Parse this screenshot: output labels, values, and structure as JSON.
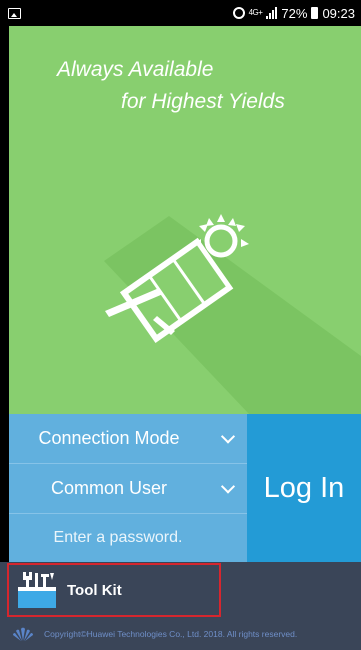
{
  "status_bar": {
    "network": "4G+",
    "battery": "72%",
    "time": "09:23"
  },
  "hero": {
    "tagline_line1": "Always Available",
    "tagline_line2": "for Highest Yields"
  },
  "login": {
    "connection_mode_label": "Connection Mode",
    "user_type_label": "Common User",
    "password_placeholder": "Enter a password.",
    "login_button": "Log In"
  },
  "toolkit": {
    "label": "Tool Kit"
  },
  "footer": {
    "copyright": "Copyright©Huawei Technologies Co., Ltd. 2018. All rights reserved."
  },
  "colors": {
    "hero_bg": "#88cf6f",
    "panel_blue": "#61b0de",
    "login_blue": "#239bd6",
    "toolbar_bg": "#3a4558",
    "highlight_red": "#d6262e"
  }
}
